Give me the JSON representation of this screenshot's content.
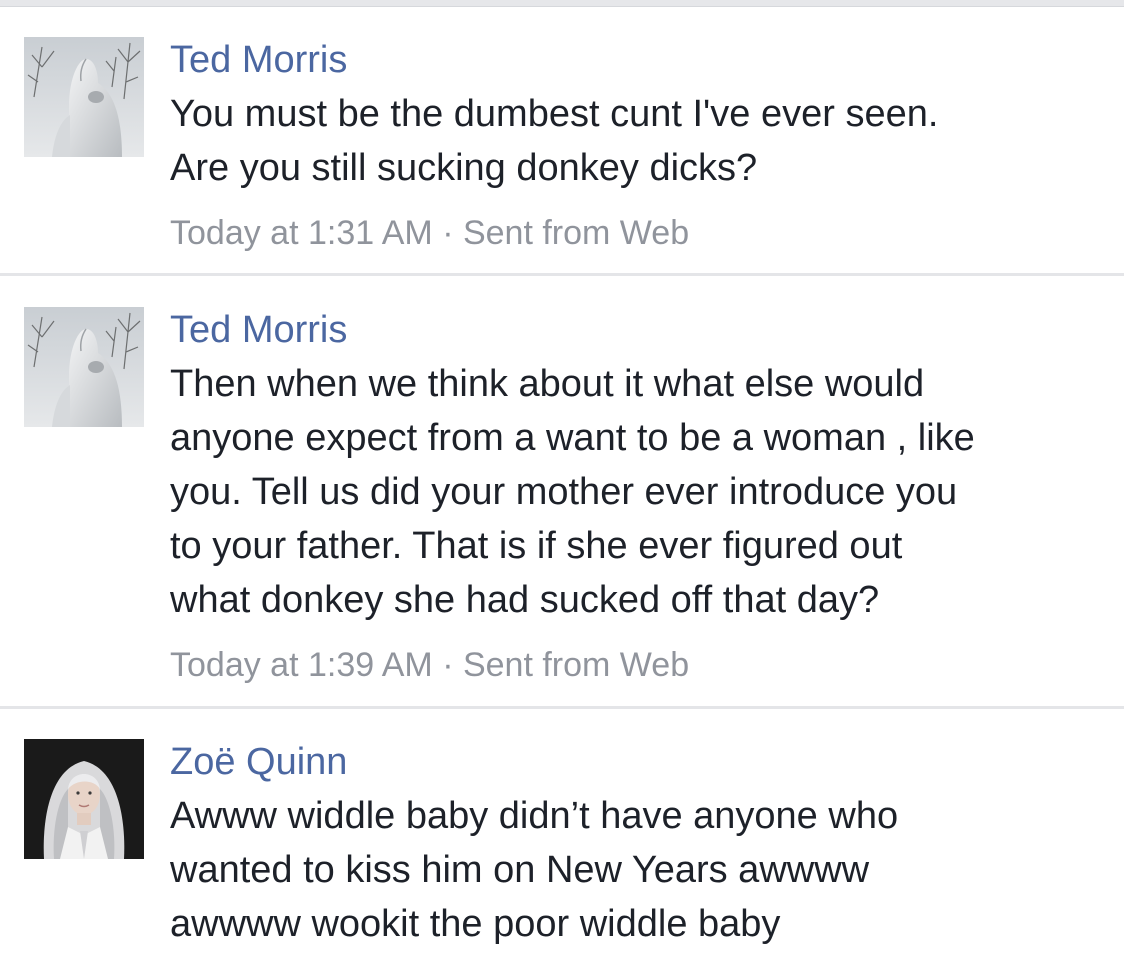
{
  "messages": [
    {
      "sender": "Ted Morris",
      "avatar": "snow-sculpture-avatar",
      "text": "You must be the dumbest cunt I've ever seen.\nAre you still sucking donkey dicks?",
      "time": "Today at 1:31 AM",
      "separator": "·",
      "source": "Sent from Web"
    },
    {
      "sender": "Ted Morris",
      "avatar": "snow-sculpture-avatar",
      "text": "Then when we think about it what else would\nanyone expect from a want to be a woman , like\nyou. Tell us did your mother ever introduce you\nto your father. That is if she ever figured out\nwhat donkey she had sucked off that day?",
      "time": "Today at 1:39 AM",
      "separator": "·",
      "source": "Sent from Web"
    },
    {
      "sender": "Zoë Quinn",
      "avatar": "portrait-avatar",
      "text": "Awww widdle baby didn’t have anyone who\nwanted to kiss him on New Years awwww\nawwww wookit the poor widdle baby"
    }
  ]
}
